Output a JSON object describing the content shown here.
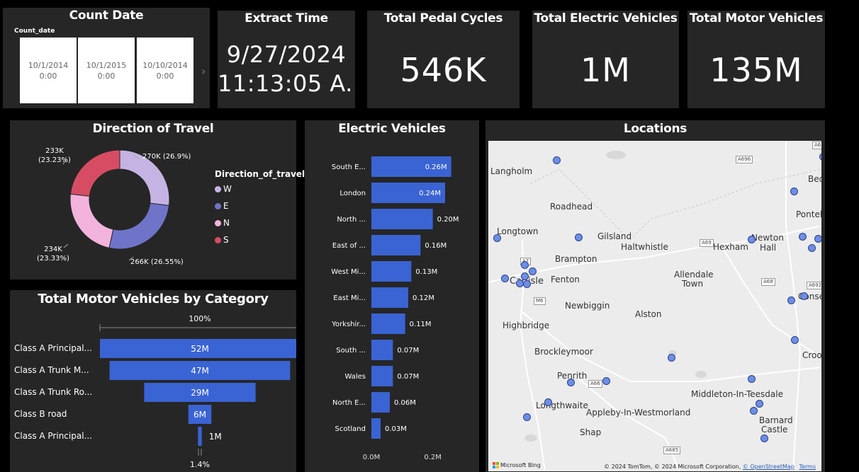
{
  "count_date": {
    "title": "Count Date",
    "field_label": "Count_date",
    "tiles": [
      {
        "date": "10/1/2014",
        "time": "0:00"
      },
      {
        "date": "10/1/2015",
        "time": "0:00"
      },
      {
        "date": "10/10/2014",
        "time": "0:00"
      }
    ]
  },
  "extract_time": {
    "title": "Extract Time",
    "date": "9/27/2024",
    "time": "11:13:05 A..."
  },
  "kpis": [
    {
      "title": "Total Pedal Cycles",
      "value": "546K"
    },
    {
      "title": "Total Electric Vehicles",
      "value": "1M"
    },
    {
      "title": "Total Motor Vehicles",
      "value": "135M"
    }
  ],
  "direction": {
    "title": "Direction of Travel",
    "legend_title": "Direction_of_travel",
    "chart_data": {
      "type": "pie",
      "slices": [
        {
          "name": "W",
          "value": 270,
          "label": "270K (26.9%)",
          "color": "#c5b4e3"
        },
        {
          "name": "E",
          "value": 266,
          "label": "266K (26.55%)",
          "color": "#6f74c9"
        },
        {
          "name": "N",
          "value": 234,
          "label": "234K (23.33%)",
          "color": "#f2b4dc"
        },
        {
          "name": "S",
          "value": 233,
          "label": "233K (23.23%)",
          "color": "#d64d63"
        }
      ]
    },
    "label_top_left": [
      "233K",
      "(23.23%)"
    ],
    "label_bottom_left": [
      "234K",
      "(23.33%)"
    ],
    "label_top_right": "270K (26.9%)",
    "label_bottom_right": "266K (26.55%)"
  },
  "electric": {
    "title": "Electric Vehicles",
    "chart_data": {
      "type": "bar",
      "categories": [
        "South E...",
        "London",
        "North ...",
        "East of ...",
        "West Mi...",
        "East Mi...",
        "Yorkshir...",
        "South ...",
        "Wales",
        "North E...",
        "Scotland"
      ],
      "values": [
        0.26,
        0.24,
        0.2,
        0.16,
        0.13,
        0.12,
        0.11,
        0.07,
        0.07,
        0.06,
        0.03
      ],
      "value_labels": [
        "0.26M",
        "0.24M",
        "0.20M",
        "0.16M",
        "0.13M",
        "0.12M",
        "0.11M",
        "0.07M",
        "0.07M",
        "0.06M",
        "0.03M"
      ],
      "xticks": [
        "0.0M",
        "0.2M"
      ],
      "xlim": [
        0,
        0.3
      ],
      "color": "#3a63d3"
    }
  },
  "funnel": {
    "title": "Total Motor Vehicles by Category",
    "top_pct": "100%",
    "bottom_pct": "1.4%",
    "chart_data": {
      "type": "bar",
      "categories": [
        "Class A Principal...",
        "Class A Trunk M...",
        "Class A Trunk Ro...",
        "Class B road",
        "Class A Principal..."
      ],
      "values": [
        52,
        47,
        29,
        6,
        1
      ],
      "value_labels": [
        "52M",
        "47M",
        "29M",
        "6M",
        "1M"
      ],
      "color": "#3a63d3"
    }
  },
  "map": {
    "title": "Locations",
    "places": [
      {
        "name": "Langholm"
      },
      {
        "name": "Roadhead"
      },
      {
        "name": "Longtown"
      },
      {
        "name": "Gilsland"
      },
      {
        "name": "Brampton"
      },
      {
        "name": "Haltwhistle"
      },
      {
        "name": "Hexham"
      },
      {
        "name": "Newton"
      },
      {
        "name": "Hall"
      },
      {
        "name": "Allendale"
      },
      {
        "name": "Town"
      },
      {
        "name": "Carlisle"
      },
      {
        "name": "Fenton"
      },
      {
        "name": "Newbiggin"
      },
      {
        "name": "Alston"
      },
      {
        "name": "Highbridge"
      },
      {
        "name": "Brockleymoor"
      },
      {
        "name": "Penrith"
      },
      {
        "name": "Middleton-In-Teesdale"
      },
      {
        "name": "Longthwaite"
      },
      {
        "name": "Appleby-In-Westmorland"
      },
      {
        "name": "Barnard"
      },
      {
        "name": "Castle"
      },
      {
        "name": "Shap"
      },
      {
        "name": "Pontel"
      },
      {
        "name": "Bed"
      },
      {
        "name": "Conset"
      },
      {
        "name": "Croo"
      }
    ],
    "roads": [
      "A696",
      "A69",
      "A68",
      "M6",
      "A66",
      "A685",
      "A692",
      "A6",
      "A7"
    ],
    "attribution_prefix": "© 2024 TomTom, © 2024 Microsoft Corporation,",
    "attribution_link": "© OpenStreetMap",
    "terms": "Terms",
    "bing_label": "Microsoft Bing"
  }
}
